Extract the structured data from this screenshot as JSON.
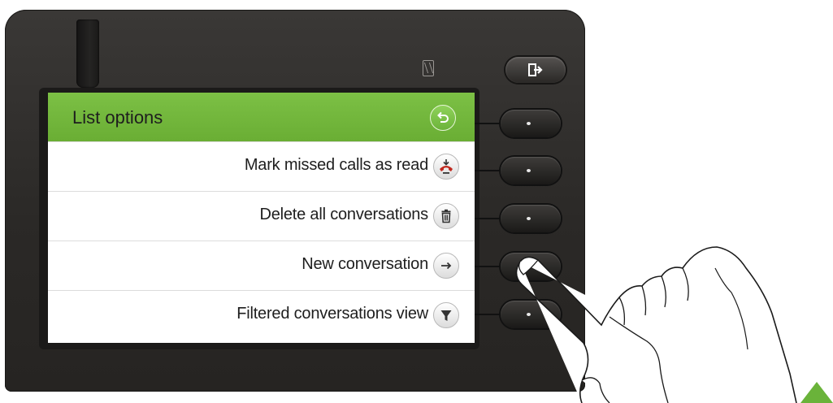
{
  "screen": {
    "title": "List options",
    "back_icon": "back-arrow-icon",
    "items": [
      {
        "label": "Mark missed calls as read",
        "icon": "missed-call-icon"
      },
      {
        "label": "Delete all conversations",
        "icon": "trash-icon"
      },
      {
        "label": "New conversation",
        "icon": "arrow-right-icon"
      },
      {
        "label": "Filtered conversations view",
        "icon": "filter-icon"
      }
    ]
  },
  "colors": {
    "header_green": "#6aae34",
    "accent_green": "#6ab33a",
    "phone_body": "#2b2927",
    "missed_call_red": "#c0281e"
  }
}
